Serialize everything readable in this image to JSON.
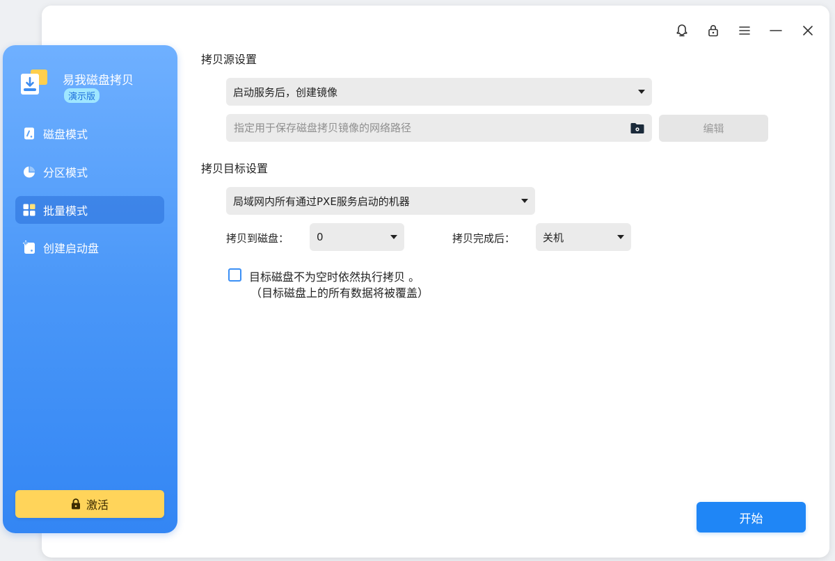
{
  "app": {
    "name": "易我磁盘拷贝",
    "edition": "演示版"
  },
  "sidebar": {
    "items": [
      {
        "label": "磁盘模式",
        "icon": "disk-mode-icon"
      },
      {
        "label": "分区模式",
        "icon": "partition-mode-icon"
      },
      {
        "label": "批量模式",
        "icon": "batch-mode-icon",
        "active": true
      },
      {
        "label": "创建启动盘",
        "icon": "create-boot-disk-icon"
      }
    ],
    "activate_label": "激活"
  },
  "topbar": {
    "icons": [
      "support-icon",
      "lock-icon",
      "menu-icon",
      "minimize-icon",
      "close-icon"
    ]
  },
  "source": {
    "title": "拷贝源设置",
    "mode_value": "启动服务后，创建镜像",
    "path_placeholder": "指定用于保存磁盘拷贝镜像的网络路径",
    "edit_label": "编辑"
  },
  "target": {
    "title": "拷贝目标设置",
    "machines_value": "局域网内所有通过PXE服务启动的机器",
    "disk_label": "拷贝到磁盘：",
    "disk_value": "0",
    "after_label": "拷贝完成后：",
    "after_value": "关机",
    "force_copy_text": "目标磁盘不为空时依然执行拷贝 。",
    "force_copy_note": "（目标磁盘上的所有数据将被覆盖）",
    "force_copy_checked": false
  },
  "start_label": "开始",
  "colors": {
    "accent": "#1f86f6",
    "sidebar_top": "#6fb0ff",
    "sidebar_bottom": "#3386f4",
    "activate": "#ffd45a"
  }
}
